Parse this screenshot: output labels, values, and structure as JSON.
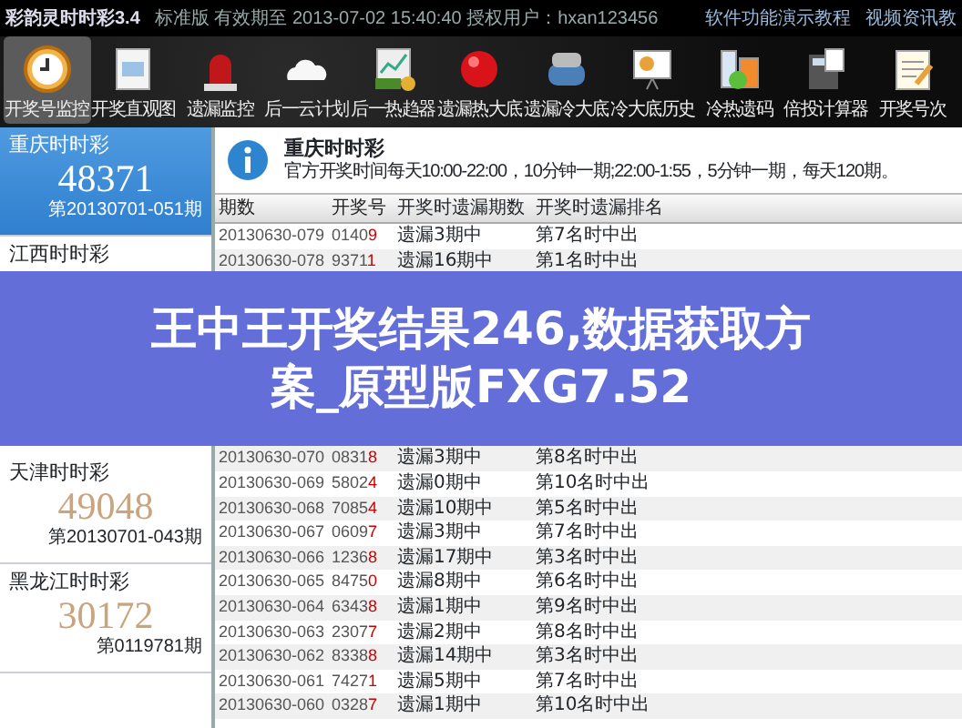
{
  "title_bar": {
    "app_name": "彩韵灵时时彩3.4",
    "license": "标准版 有效期至 2013-07-02 15:40:40 授权用户：hxan123456",
    "links": [
      "软件功能演示教程",
      "视频资讯教"
    ]
  },
  "toolbar": [
    {
      "label": "开奖号监控",
      "kind": "clock",
      "selected": true
    },
    {
      "label": "开奖直观图",
      "kind": "sheet",
      "selected": false
    },
    {
      "label": "遗漏监控",
      "kind": "siren",
      "selected": false
    },
    {
      "label": "后一云计划",
      "kind": "cloud",
      "selected": false
    },
    {
      "label": "后一热趋器",
      "kind": "chart",
      "selected": false
    },
    {
      "label": "遗漏热大底",
      "kind": "ball",
      "selected": false
    },
    {
      "label": "遗漏冷大底",
      "kind": "roller",
      "selected": false
    },
    {
      "label": "冷大底历史",
      "kind": "board",
      "selected": false
    },
    {
      "label": "冷热遗码",
      "kind": "flask",
      "selected": false
    },
    {
      "label": "倍投计算器",
      "kind": "calc",
      "selected": false
    },
    {
      "label": "开奖号次",
      "kind": "notepad",
      "selected": false
    }
  ],
  "sidebar": [
    {
      "name": "重庆时时彩",
      "number": "48371",
      "period": "第20130701-051期",
      "selected": true
    },
    {
      "name": "江西时时彩",
      "selected": false
    },
    {
      "kind": "covered"
    },
    {
      "name": "天津时时彩",
      "number": "49048",
      "period": "第20130701-043期",
      "selected": false
    },
    {
      "name": "黑龙江时时彩",
      "number": "30172",
      "period": "第0119781期",
      "selected": false
    }
  ],
  "info": {
    "title": "重庆时时彩",
    "text": "官方开奖时间每天10:00-22:00，10分钟一期;22:00-1:55，5分钟一期，每天120期。"
  },
  "table": {
    "columns": [
      "期数",
      "开奖号",
      "开奖时遗漏期数",
      "开奖时遗漏排名"
    ],
    "rows": [
      [
        "20130630-079",
        "01409",
        "遗漏3期中",
        "第7名时中出"
      ],
      [
        "20130630-078",
        "93711",
        "遗漏16期中",
        "第1名时中出"
      ],
      {
        "kind": "covered"
      },
      {
        "kind": "covered"
      },
      {
        "kind": "covered"
      },
      {
        "kind": "covered"
      },
      {
        "kind": "covered"
      },
      {
        "kind": "covered"
      },
      {
        "kind": "covered"
      },
      [
        "20130630-070",
        "08318",
        "遗漏3期中",
        "第8名时中出"
      ],
      [
        "20130630-069",
        "58024",
        "遗漏0期中",
        "第10名时中出"
      ],
      [
        "20130630-068",
        "70854",
        "遗漏10期中",
        "第5名时中出"
      ],
      [
        "20130630-067",
        "06097",
        "遗漏3期中",
        "第7名时中出"
      ],
      [
        "20130630-066",
        "12368",
        "遗漏17期中",
        "第3名时中出"
      ],
      [
        "20130630-065",
        "84750",
        "遗漏8期中",
        "第6名时中出"
      ],
      [
        "20130630-064",
        "63438",
        "遗漏1期中",
        "第9名时中出"
      ],
      [
        "20130630-063",
        "23077",
        "遗漏2期中",
        "第8名时中出"
      ],
      [
        "20130630-062",
        "83388",
        "遗漏14期中",
        "第3名时中出"
      ],
      [
        "20130630-061",
        "74271",
        "遗漏5期中",
        "第7名时中出"
      ],
      [
        "20130630-060",
        "03287",
        "遗漏1期中",
        "第10名时中出"
      ]
    ]
  },
  "caption_banner": [
    "王中王开奖结果246,数据获取方",
    "案_原型版FXG7.52"
  ]
}
